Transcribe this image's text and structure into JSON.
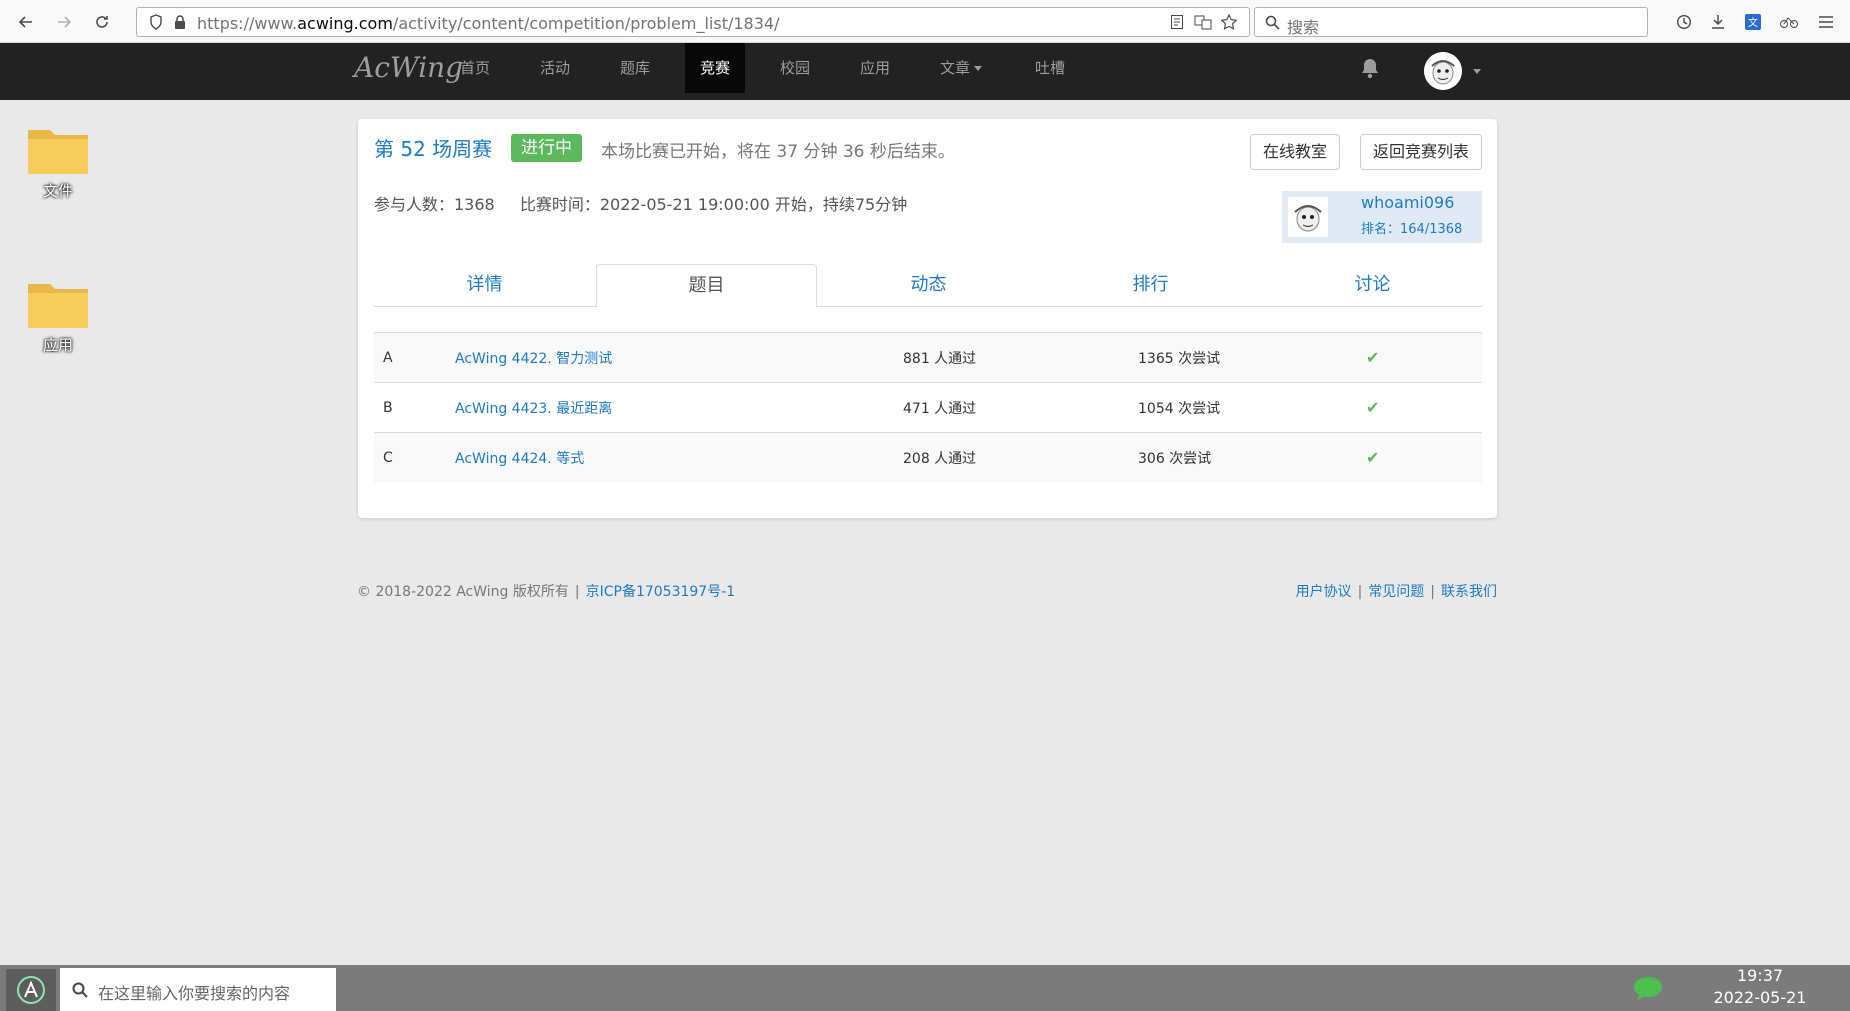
{
  "browser": {
    "url_prefix": "https://www.",
    "url_domain": "acwing.com",
    "url_path": "/activity/content/competition/problem_list/1834/",
    "search_placeholder": "搜索"
  },
  "site": {
    "brand": "AcWing",
    "nav": [
      "首页",
      "活动",
      "题库",
      "竞赛",
      "校园",
      "应用",
      "文章",
      "吐槽"
    ],
    "active_nav": "竞赛"
  },
  "desktop": {
    "icons": [
      {
        "label": "文件"
      },
      {
        "label": "应用"
      }
    ]
  },
  "competition": {
    "title": "第 52 场周赛",
    "status_badge": "进行中",
    "status_text": "本场比赛已开始，将在 37 分钟 36 秒后结束。",
    "online_room_button": "在线教室",
    "back_button": "返回竞赛列表",
    "participants": "参与人数：1368",
    "time": "比赛时间：2022-05-21 19:00:00 开始，持续75分钟",
    "user": {
      "name": "whoami096",
      "rank": "排名：164/1368"
    },
    "tabs": [
      "详情",
      "题目",
      "动态",
      "排行",
      "讨论"
    ],
    "active_tab": "题目",
    "problems": [
      {
        "letter": "A",
        "title": "AcWing 4422. 智力测试",
        "passed": "881 人通过",
        "attempts": "1365 次尝试"
      },
      {
        "letter": "B",
        "title": "AcWing 4423. 最近距离",
        "passed": "471 人通过",
        "attempts": "1054 次尝试"
      },
      {
        "letter": "C",
        "title": "AcWing 4424. 等式",
        "passed": "208 人通过",
        "attempts": "306 次尝试"
      }
    ]
  },
  "footer": {
    "copyright": "© 2018-2022 AcWing 版权所有",
    "sep": "|",
    "icp": "京ICP备17053197号-1",
    "links": [
      "用户协议",
      "常见问题",
      "联系我们"
    ]
  },
  "taskbar": {
    "search_placeholder": "在这里输入你要搜索的内容",
    "time": "19:37",
    "date": "2022-05-21"
  },
  "colors": {
    "link": "#1e7ac4",
    "success": "#5cb85c",
    "navbar": "#222222"
  }
}
